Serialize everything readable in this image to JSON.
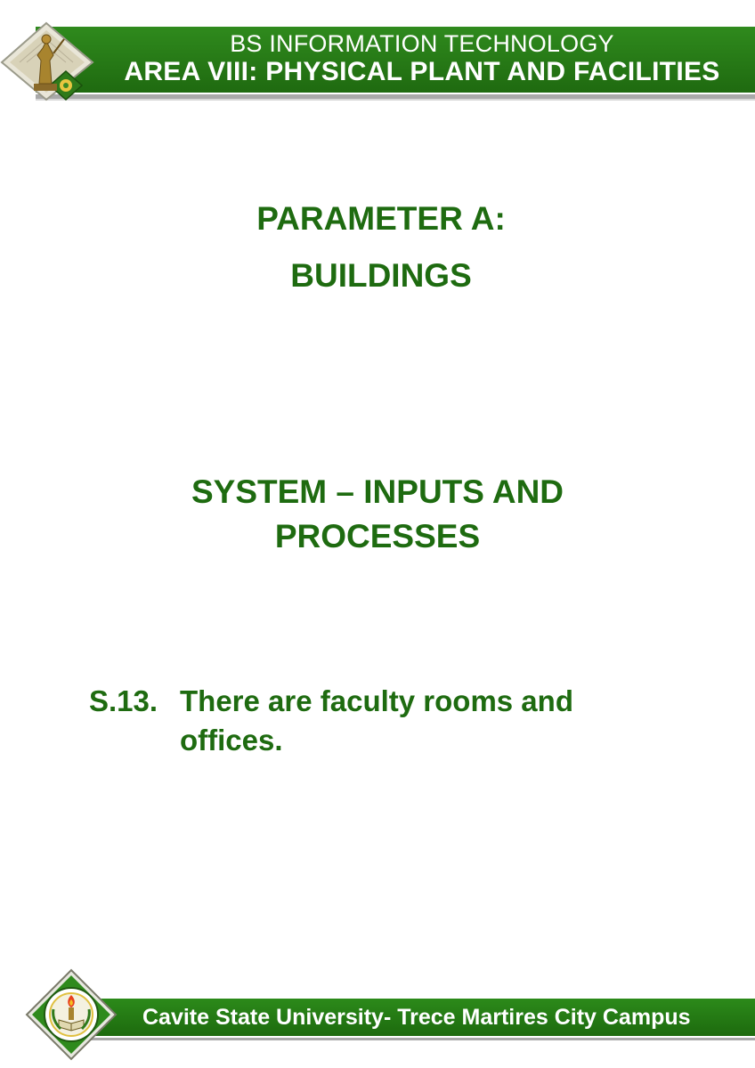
{
  "header": {
    "subtitle": "BS INFORMATION TECHNOLOGY",
    "title": "AREA VIII: PHYSICAL PLANT AND FACILITIES"
  },
  "parameter": {
    "line1": "PARAMETER A:",
    "line2": "BUILDINGS"
  },
  "section": {
    "line1": "SYSTEM – INPUTS AND",
    "line2": "PROCESSES"
  },
  "item": {
    "number": "S.13.",
    "text": "There are faculty rooms and offices."
  },
  "footer": {
    "text": "Cavite State University- Trece Martires City Campus"
  },
  "colors": {
    "brand_green": "#1e6b10",
    "band_green": "#2f8a1d",
    "accent_gold": "#c9a227"
  },
  "icons": {
    "top_logo": "university-statue-logo-icon",
    "bottom_logo": "university-seal-icon"
  }
}
